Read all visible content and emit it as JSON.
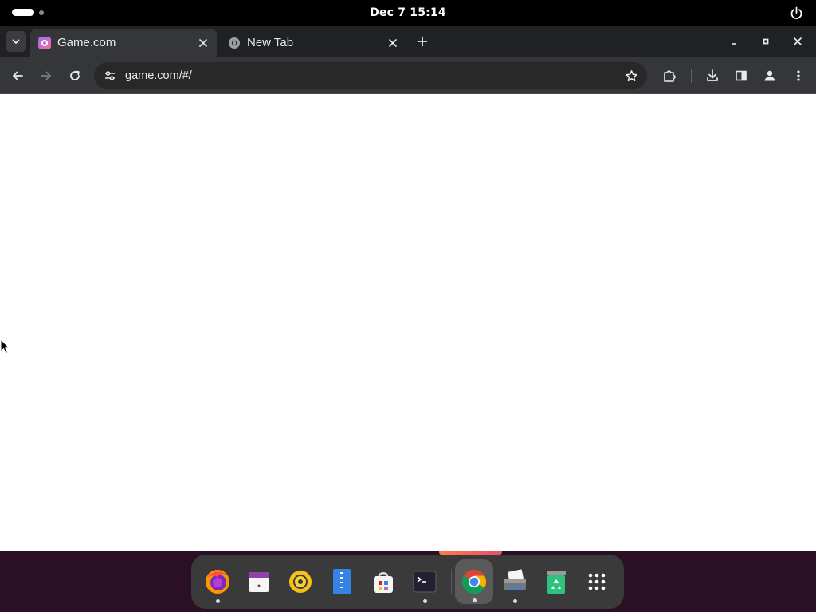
{
  "topbar": {
    "datetime": "Dec 7  15:14"
  },
  "browser": {
    "tabs": [
      {
        "title": "Game.com",
        "active": true,
        "icon": "game-favicon"
      },
      {
        "title": "New Tab",
        "active": false,
        "icon": "chrome-favicon"
      }
    ],
    "address": "game.com/#/"
  },
  "dock": {
    "apps": [
      {
        "name": "firefox",
        "running": true
      },
      {
        "name": "calendar",
        "running": false
      },
      {
        "name": "rhythmbox",
        "running": false
      },
      {
        "name": "text-editor",
        "running": false
      },
      {
        "name": "software-center",
        "running": false
      },
      {
        "name": "terminal",
        "running": true
      },
      {
        "name": "chrome",
        "running": true
      },
      {
        "name": "file-printer",
        "running": true
      },
      {
        "name": "trash",
        "running": false
      },
      {
        "name": "app-grid",
        "running": false
      }
    ]
  },
  "colors": {
    "topbar": "#000000",
    "tabstrip": "#202124",
    "toolbar": "#35363a",
    "omnibox": "#282828",
    "desktop": "#2b0f24",
    "dock": "#3a3a3a"
  }
}
